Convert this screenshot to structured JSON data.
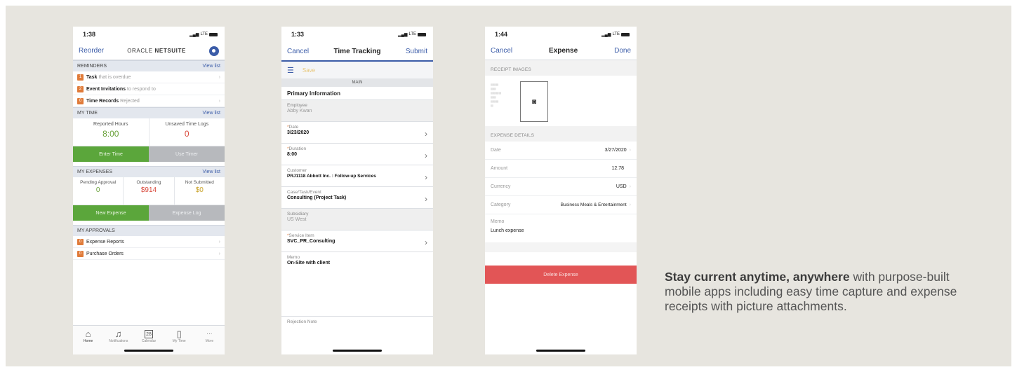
{
  "colors": {
    "background": "#e7e5df",
    "accent": "#3b5ca8",
    "green": "#5ba63b",
    "orange": "#e07b39",
    "red": "#e25556"
  },
  "status_icons": {
    "network": "LTE"
  },
  "home": {
    "time": "1:38",
    "nav": {
      "left": "Reorder",
      "logo_brand": "ORACLE",
      "logo_product": "NETSUITE",
      "avatar_icon": "user-icon"
    },
    "reminders": {
      "title": "REMINDERS",
      "view_list": "View list",
      "items": [
        {
          "count": "1",
          "bold": "Task",
          "rest": "that is overdue"
        },
        {
          "count": "2",
          "bold": "Event Invitations",
          "rest": "to respond to"
        },
        {
          "count": "0",
          "bold": "Time Records",
          "rest": "Rejected"
        }
      ]
    },
    "my_time": {
      "title": "MY TIME",
      "view_list": "View list",
      "reported_label": "Reported Hours",
      "reported_value": "8:00",
      "unsaved_label": "Unsaved Time Logs",
      "unsaved_value": "0",
      "enter_time": "Enter Time",
      "use_timer": "Use Timer"
    },
    "my_expenses": {
      "title": "MY EXPENSES",
      "view_list": "View list",
      "pending_label": "Pending Approval",
      "pending_value": "0",
      "outstanding_label": "Outstanding",
      "outstanding_value": "$914",
      "not_submitted_label": "Not Submitted",
      "not_submitted_value": "$0",
      "new_expense": "New Expense",
      "expense_log": "Expense Log"
    },
    "my_approvals": {
      "title": "MY APPROVALS",
      "items": [
        {
          "count": "0",
          "label": "Expense Reports"
        },
        {
          "count": "0",
          "label": "Purchase Orders"
        }
      ]
    },
    "tabs": [
      {
        "label": "Home",
        "icon": "home-icon"
      },
      {
        "label": "Notifications",
        "icon": "bell-icon"
      },
      {
        "label": "Calendar",
        "icon": "calendar-icon",
        "day": "28"
      },
      {
        "label": "My Time",
        "icon": "document-icon"
      },
      {
        "label": "More",
        "icon": "more-icon"
      }
    ]
  },
  "time_tracking": {
    "time": "1:33",
    "nav": {
      "left": "Cancel",
      "title": "Time Tracking",
      "right": "Submit"
    },
    "save": "Save",
    "main_tab": "MAIN",
    "section": "Primary Information",
    "fields": [
      {
        "label": "Employee",
        "value": "Abby Kwan",
        "required": false,
        "readonly": true
      },
      {
        "label": "Date",
        "value": "3/23/2020",
        "required": true,
        "readonly": false
      },
      {
        "label": "Duration",
        "value": "8:00",
        "required": true,
        "readonly": false
      },
      {
        "label": "Customer",
        "value": "PRJ1118 Abbott Inc. : Follow-up Services",
        "required": false,
        "readonly": false
      },
      {
        "label": "Case/Task/Event",
        "value": "Consulting (Project Task)",
        "required": false,
        "readonly": false
      },
      {
        "label": "Subsidiary",
        "value": "US West",
        "required": false,
        "readonly": true
      },
      {
        "label": "Service Item",
        "value": "SVC_PR_Consulting",
        "required": true,
        "readonly": false
      }
    ],
    "memo_label": "Memo",
    "memo_value": "On-Site with client",
    "rejection_label": "Rejection Note"
  },
  "expense": {
    "time": "1:44",
    "nav": {
      "left": "Cancel",
      "title": "Expense",
      "right": "Done"
    },
    "receipt_images_label": "RECEIPT IMAGES",
    "expense_details_label": "EXPENSE DETAILS",
    "rows": [
      {
        "label": "Date",
        "value": "3/27/2020"
      },
      {
        "label": "Amount",
        "value": "12.78"
      },
      {
        "label": "Currency",
        "value": "USD"
      },
      {
        "label": "Category",
        "value": "Business Meals & Entertainment"
      }
    ],
    "memo_label": "Memo",
    "memo_value": "Lunch expense",
    "delete_label": "Delete Expense"
  },
  "tagline": {
    "bold": "Stay current anytime, anywhere",
    "rest": " with purpose-built mobile apps including easy time capture and expense receipts with picture attachments."
  }
}
